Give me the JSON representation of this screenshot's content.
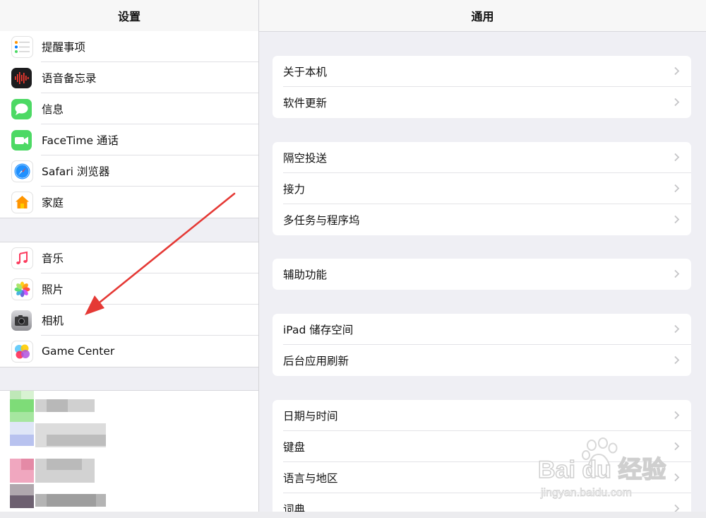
{
  "sidebar": {
    "title": "设置",
    "group1": [
      {
        "label": "提醒事项",
        "icon": "reminders-icon"
      },
      {
        "label": "语音备忘录",
        "icon": "voice-memos-icon"
      },
      {
        "label": "信息",
        "icon": "messages-icon"
      },
      {
        "label": "FaceTime 通话",
        "icon": "facetime-icon"
      },
      {
        "label": "Safari 浏览器",
        "icon": "safari-icon"
      },
      {
        "label": "家庭",
        "icon": "home-icon"
      }
    ],
    "group2": [
      {
        "label": "音乐",
        "icon": "music-icon"
      },
      {
        "label": "照片",
        "icon": "photos-icon"
      },
      {
        "label": "相机",
        "icon": "camera-icon"
      },
      {
        "label": "Game Center",
        "icon": "game-center-icon"
      }
    ]
  },
  "detail": {
    "title": "通用",
    "groups": [
      [
        "关于本机",
        "软件更新"
      ],
      [
        "隔空投送",
        "接力",
        "多任务与程序坞"
      ],
      [
        "辅助功能"
      ],
      [
        "iPad 储存空间",
        "后台应用刷新"
      ],
      [
        "日期与时间",
        "键盘",
        "语言与地区",
        "词典"
      ]
    ]
  },
  "watermark": {
    "brand": "Bai du 经验",
    "url": "jingyan.baidu.com"
  },
  "colors": {
    "accent_arrow": "#e53935",
    "background": "#efeff4",
    "separator": "#e0e0e4"
  }
}
